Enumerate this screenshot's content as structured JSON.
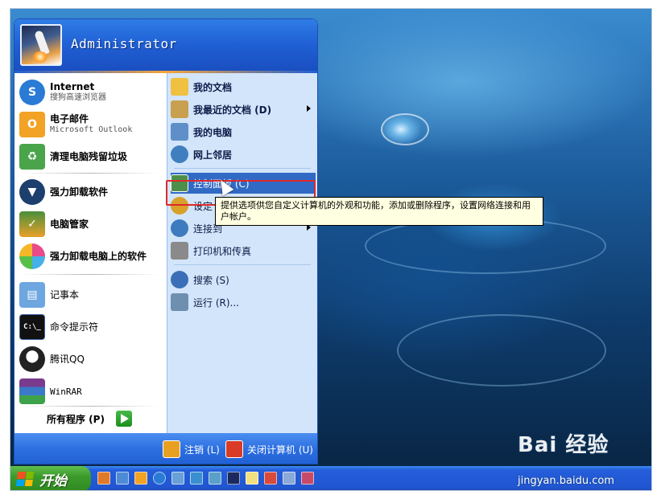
{
  "user": {
    "name": "Administrator"
  },
  "left_pinned": [
    {
      "title": "Internet",
      "subtitle": "搜狗高速浏览器",
      "icon": "sogou-browser-icon",
      "color": "#2a7bd6"
    },
    {
      "title": "电子邮件",
      "subtitle": "Microsoft Outlook",
      "icon": "outlook-icon",
      "color": "#f2a224"
    },
    {
      "title": "清理电脑残留垃圾",
      "icon": "recycle-bin-icon",
      "color": "#4aa44a"
    }
  ],
  "left_recent": [
    {
      "title": "强力卸载软件",
      "icon": "uninstaller-icon",
      "color": "#1d3f6e"
    },
    {
      "title": "电脑管家",
      "icon": "pc-manager-shield-icon",
      "color": "#4a8f3b"
    },
    {
      "title": "强力卸载电脑上的软件",
      "icon": "clover-icon",
      "color": "#e84a8a"
    }
  ],
  "left_programs": [
    {
      "title": "记事本",
      "icon": "notepad-icon",
      "color": "#6ea7e0"
    },
    {
      "title": "命令提示符",
      "icon": "cmd-icon",
      "color": "#111111"
    },
    {
      "title": "腾讯QQ",
      "icon": "qq-penguin-icon",
      "color": "#222222"
    },
    {
      "title": "WinRAR",
      "icon": "winrar-icon",
      "color": "#7a3b8f"
    }
  ],
  "all_programs": {
    "label": "所有程序 (P)"
  },
  "right_items": [
    {
      "label": "我的文档",
      "bold": true,
      "icon": "my-documents-icon",
      "color": "#f0c040"
    },
    {
      "label": "我最近的文档 (D)",
      "bold": true,
      "icon": "recent-docs-icon",
      "color": "#c8a050",
      "arrow": true
    },
    {
      "label": "我的电脑",
      "bold": true,
      "icon": "my-computer-icon",
      "color": "#5f8fc8"
    },
    {
      "label": "网上邻居",
      "bold": true,
      "icon": "network-icon",
      "color": "#3f7fc0"
    },
    {
      "label": "控制面板 (C)",
      "bold": false,
      "icon": "control-panel-icon",
      "color": "#4d8f4a",
      "highlight": true
    },
    {
      "label": "设定",
      "bold": false,
      "icon": "set-program-access-icon",
      "color": "#d9a02a"
    },
    {
      "label": "连接到",
      "bold": false,
      "icon": "connect-to-icon",
      "color": "#3c7bbd",
      "arrow": true
    },
    {
      "label": "打印机和传真",
      "bold": false,
      "icon": "printer-icon",
      "color": "#8a8a8a"
    },
    {
      "label": "搜索 (S)",
      "bold": false,
      "icon": "search-icon",
      "color": "#3a6fb8"
    },
    {
      "label": "运行 (R)...",
      "bold": false,
      "icon": "run-icon",
      "color": "#6f8fb0"
    }
  ],
  "footer": {
    "logoff": "注销 (L)",
    "shutdown": "关闭计算机 (U)"
  },
  "tooltip": {
    "text": "提供选项供您自定义计算机的外观和功能，添加或删除程序，设置网络连接和用户帐户。"
  },
  "taskbar": {
    "start_label": "开始",
    "quick_launch": [
      "show-desktop-icon",
      "ie-icon",
      "media-player-icon",
      "sogou-icon",
      "security-icon",
      "qq-icon",
      "network-tool-icon",
      "photoshop-icon",
      "notepad-tool-icon",
      "paint-icon",
      "grid-tool-icon",
      "system-tool-icon"
    ]
  },
  "watermark": {
    "brand": "Bai 经验",
    "url": "jingyan.baidu.com"
  }
}
